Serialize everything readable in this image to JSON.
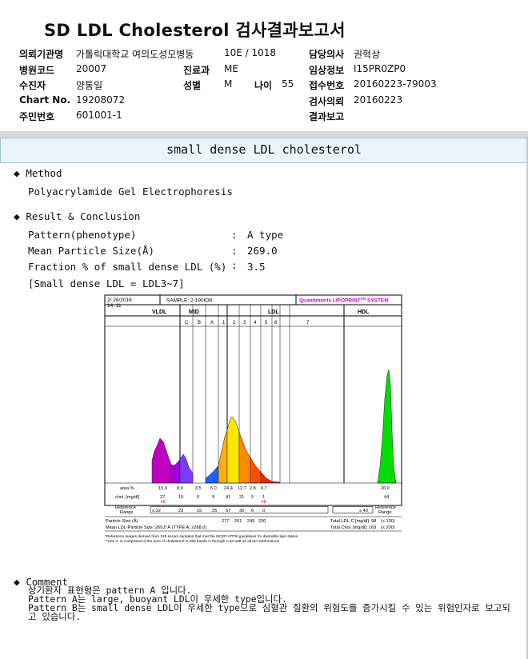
{
  "title": "SD LDL Cholesterol 검사결과보고서",
  "header": {
    "institution_label": "의뢰기관명",
    "institution_value": "가톨릭대학교 여의도성모병동",
    "ward_value": "10E / 1018",
    "doctor_label": "담당의사",
    "doctor_value": "권혁상",
    "hospital_code_label": "병원코드",
    "hospital_code_value": "20007",
    "dept_label": "진료과",
    "dept_value": "ME",
    "clinical_label": "임상정보",
    "clinical_value": "I15PR0ZP0",
    "patient_label": "수진자",
    "patient_value": "양통일",
    "sex_label": "성별",
    "sex_value": "M",
    "age_label": "나이",
    "age_value": "55",
    "receipt_label": "접수번호",
    "receipt_value": "20160223-79003",
    "chart_label": "Chart No.",
    "chart_value": "19208072",
    "request_label": "검사의뢰",
    "request_value": "20160223",
    "rrn_label": "주민번호",
    "rrn_value": "601001-1",
    "report_label": "결과보고"
  },
  "section_title": "small dense LDL cholesterol",
  "method": {
    "bullet": "◆",
    "label": "Method",
    "value": "Polyacrylamide Gel Electrophoresis"
  },
  "result": {
    "bullet": "◆",
    "label": "Result & Conclusion",
    "rows": [
      {
        "label": "Pattern(phenotype)",
        "colon": ":",
        "value": "A type"
      },
      {
        "label": "Mean Particle Size(Å)",
        "colon": ":",
        "value": "269.0"
      },
      {
        "label": "Fraction % of small dense LDL (%)",
        "colon": ":",
        "value": "3.5"
      }
    ],
    "note": "[Small dense LDL = LDL3~7]"
  },
  "lipoprint": {
    "date": "2/ 26/2016",
    "time": "14: 11",
    "sample": "SAMPLE:   2-190636",
    "brand": "Quantimetrix LIPOPRINT",
    "brand_tm": "TM",
    "brand_suffix": " SYSTEM",
    "zones": {
      "vldl": "VLDL",
      "mid": "MID",
      "ldl": "LDL",
      "hdl": "HDL"
    },
    "bands": [
      "C",
      "B",
      "A",
      "1",
      "2",
      "3",
      "4",
      "5",
      "6",
      "7"
    ],
    "rows": {
      "area_label": "area %",
      "area": [
        "15.9",
        "8.9",
        "3.5",
        "5.0",
        "24.4",
        "12.7",
        "2.8",
        "0.7"
      ],
      "area_hdl": "26.0",
      "chol_label": "chol. [mg/dl]",
      "chol": [
        "27",
        "15",
        "6",
        "9",
        "41",
        "21",
        "5",
        "1"
      ],
      "chol_hdl": "44",
      "hi_label": "HI",
      "ref_label_1": "Reference",
      "ref_label_2": "Range",
      "ref": [
        "≤ 22",
        "23",
        "15",
        "25",
        "57",
        "30",
        "6",
        "0"
      ],
      "ref_hdl": "≥ 40",
      "ref_right_1": "Reference",
      "ref_right_2": "Range",
      "size_label": "Particle-Size (Å)",
      "size": [
        "277",
        "261",
        "245",
        "230"
      ],
      "total_ldl": "Total LDL-C [mg/dl]:  98",
      "total_ldl_ref": "(≤ 130)",
      "mean_size": "Mean LDL-Particle Size:  269.0 Å  (TYPE A; ≥268.0)",
      "total_chol": "Total Chol. [mg/dl]:  169",
      "total_chol_ref": "(≤ 200)"
    },
    "footnote1": "*Reference ranges derived from 125 serum samples that met the NCEP ATPIII guidelines for desirable lipid status",
    "footnote2": "**LDL-C is comprised of the sum of cholesterol in Mid bands C through A as well as all the subfractions"
  },
  "comment": {
    "bullet": "◆",
    "label": "Comment",
    "lines": [
      "상기환자 표현형은 pattern A 입니다.",
      "Pattern A는 large, buoyant LDL이 우세한 type입니다.",
      "Pattern B는 small dense LDL이 우세한 type으로 심혈관 질환의 위험도를 증가시킬 수 있는 위험인자로 보고되",
      "고 있습니다."
    ]
  },
  "colors": {
    "vldl": "#c000c0",
    "midc": "#a000e0",
    "midb": "#7a3cff",
    "mida": "#2060ff",
    "ldl1": "#ffd000",
    "ldl2": "#ffe600",
    "ldl3": "#ff8800",
    "ldl4": "#ff5000",
    "ldl5": "#ff2000",
    "hdl": "#00dd00",
    "brand": "#cc00cc",
    "band_bg": "#eaf4fb"
  }
}
